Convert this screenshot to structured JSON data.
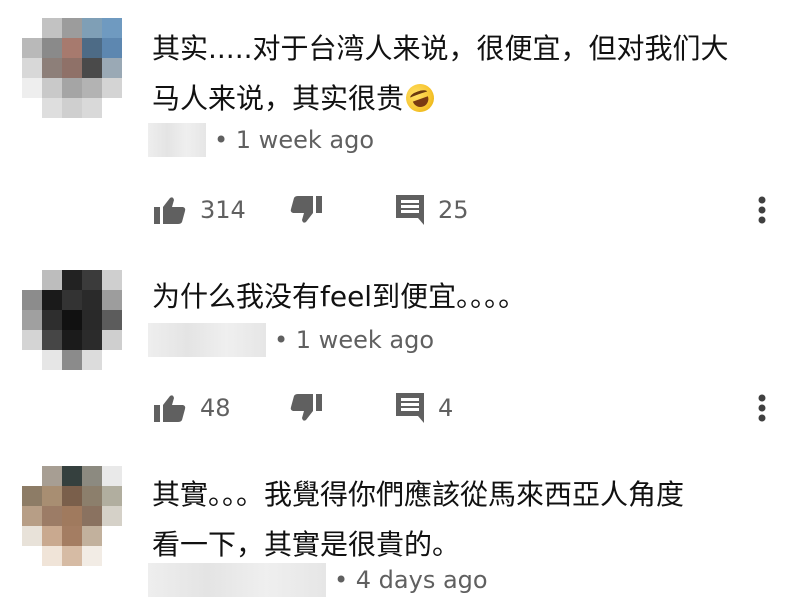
{
  "comments": [
    {
      "text": "其实.....对于台湾人来说，很便宜，但对我们大\n马人来说，其实很贵",
      "emoji": "rolling-on-floor-laughing-emoji",
      "time": "• 1 week ago",
      "likes": "314",
      "replies": "25",
      "avatar_colors": [
        "#ffffff",
        "#c2c2c2",
        "#9c9c9c",
        "#7f9fb6",
        "#6f9ac0",
        "#b9b9b9",
        "#8a8a8a",
        "#a77a6e",
        "#4d6b86",
        "#5d87b0",
        "#d8d8d8",
        "#8d7f79",
        "#8f7168",
        "#4a4a4a",
        "#9aa9b5",
        "#eeeeee",
        "#c9c9c9",
        "#a5a5a5",
        "#b3b3b3",
        "#d4d4d4",
        "#ffffff",
        "#dedede",
        "#cfcfcf",
        "#d9d9d9",
        "#ffffff"
      ]
    },
    {
      "text": "为什么我没有feel到便宜。。。。",
      "time": "• 1 week ago",
      "likes": "48",
      "replies": "4",
      "avatar_colors": [
        "#ffffff",
        "#bdbdbd",
        "#222222",
        "#3b3b3b",
        "#cfcfcf",
        "#8c8c8c",
        "#1a1a1a",
        "#333333",
        "#2a2a2a",
        "#9d9d9d",
        "#a0a0a0",
        "#2e2e2e",
        "#111111",
        "#292929",
        "#5c5c5c",
        "#d4d4d4",
        "#464646",
        "#1b1b1b",
        "#2b2b2b",
        "#cfcfcf",
        "#ffffff",
        "#e6e6e6",
        "#8b8b8b",
        "#dcdcdc",
        "#ffffff"
      ]
    },
    {
      "text": "其實。。。我覺得你們應該從馬來西亞人角度\n看一下，其實是很貴的。",
      "time": "• 4 days ago",
      "avatar_colors": [
        "#ffffff",
        "#a79e93",
        "#35403e",
        "#8c8a80",
        "#e9e9e9",
        "#8d7c66",
        "#a88e72",
        "#7a5f4b",
        "#8c7f6c",
        "#b1ae9f",
        "#b79e86",
        "#9c7c66",
        "#a07a5e",
        "#8a7260",
        "#d5d1c8",
        "#e8e2d9",
        "#c9a98f",
        "#a47d62",
        "#c2b19d",
        "#ffffff",
        "#ffffff",
        "#f0e4d8",
        "#d6bba4",
        "#f2ece5",
        "#ffffff"
      ]
    }
  ]
}
